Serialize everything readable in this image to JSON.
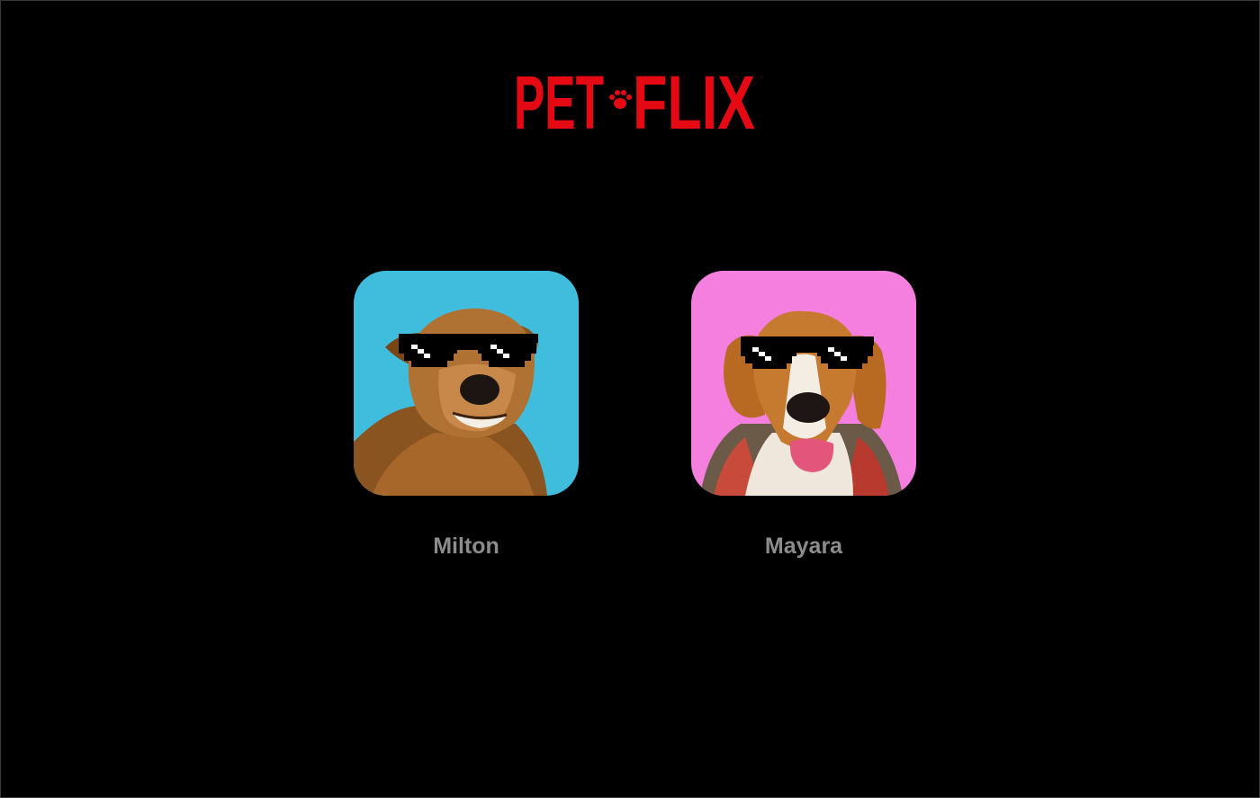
{
  "brand": {
    "logo_text": "PET FLIX",
    "logo_color": "#e50914",
    "icon": "paw-icon"
  },
  "profiles": [
    {
      "name": "Milton",
      "background": "#40bcdd",
      "avatar_icon": "dog-with-pixel-sunglasses-icon"
    },
    {
      "name": "Mayara",
      "background": "#f47fdf",
      "avatar_icon": "beagle-with-pixel-sunglasses-icon"
    }
  ],
  "theme": {
    "background": "#000000",
    "name_color": "#8c8c8c"
  }
}
